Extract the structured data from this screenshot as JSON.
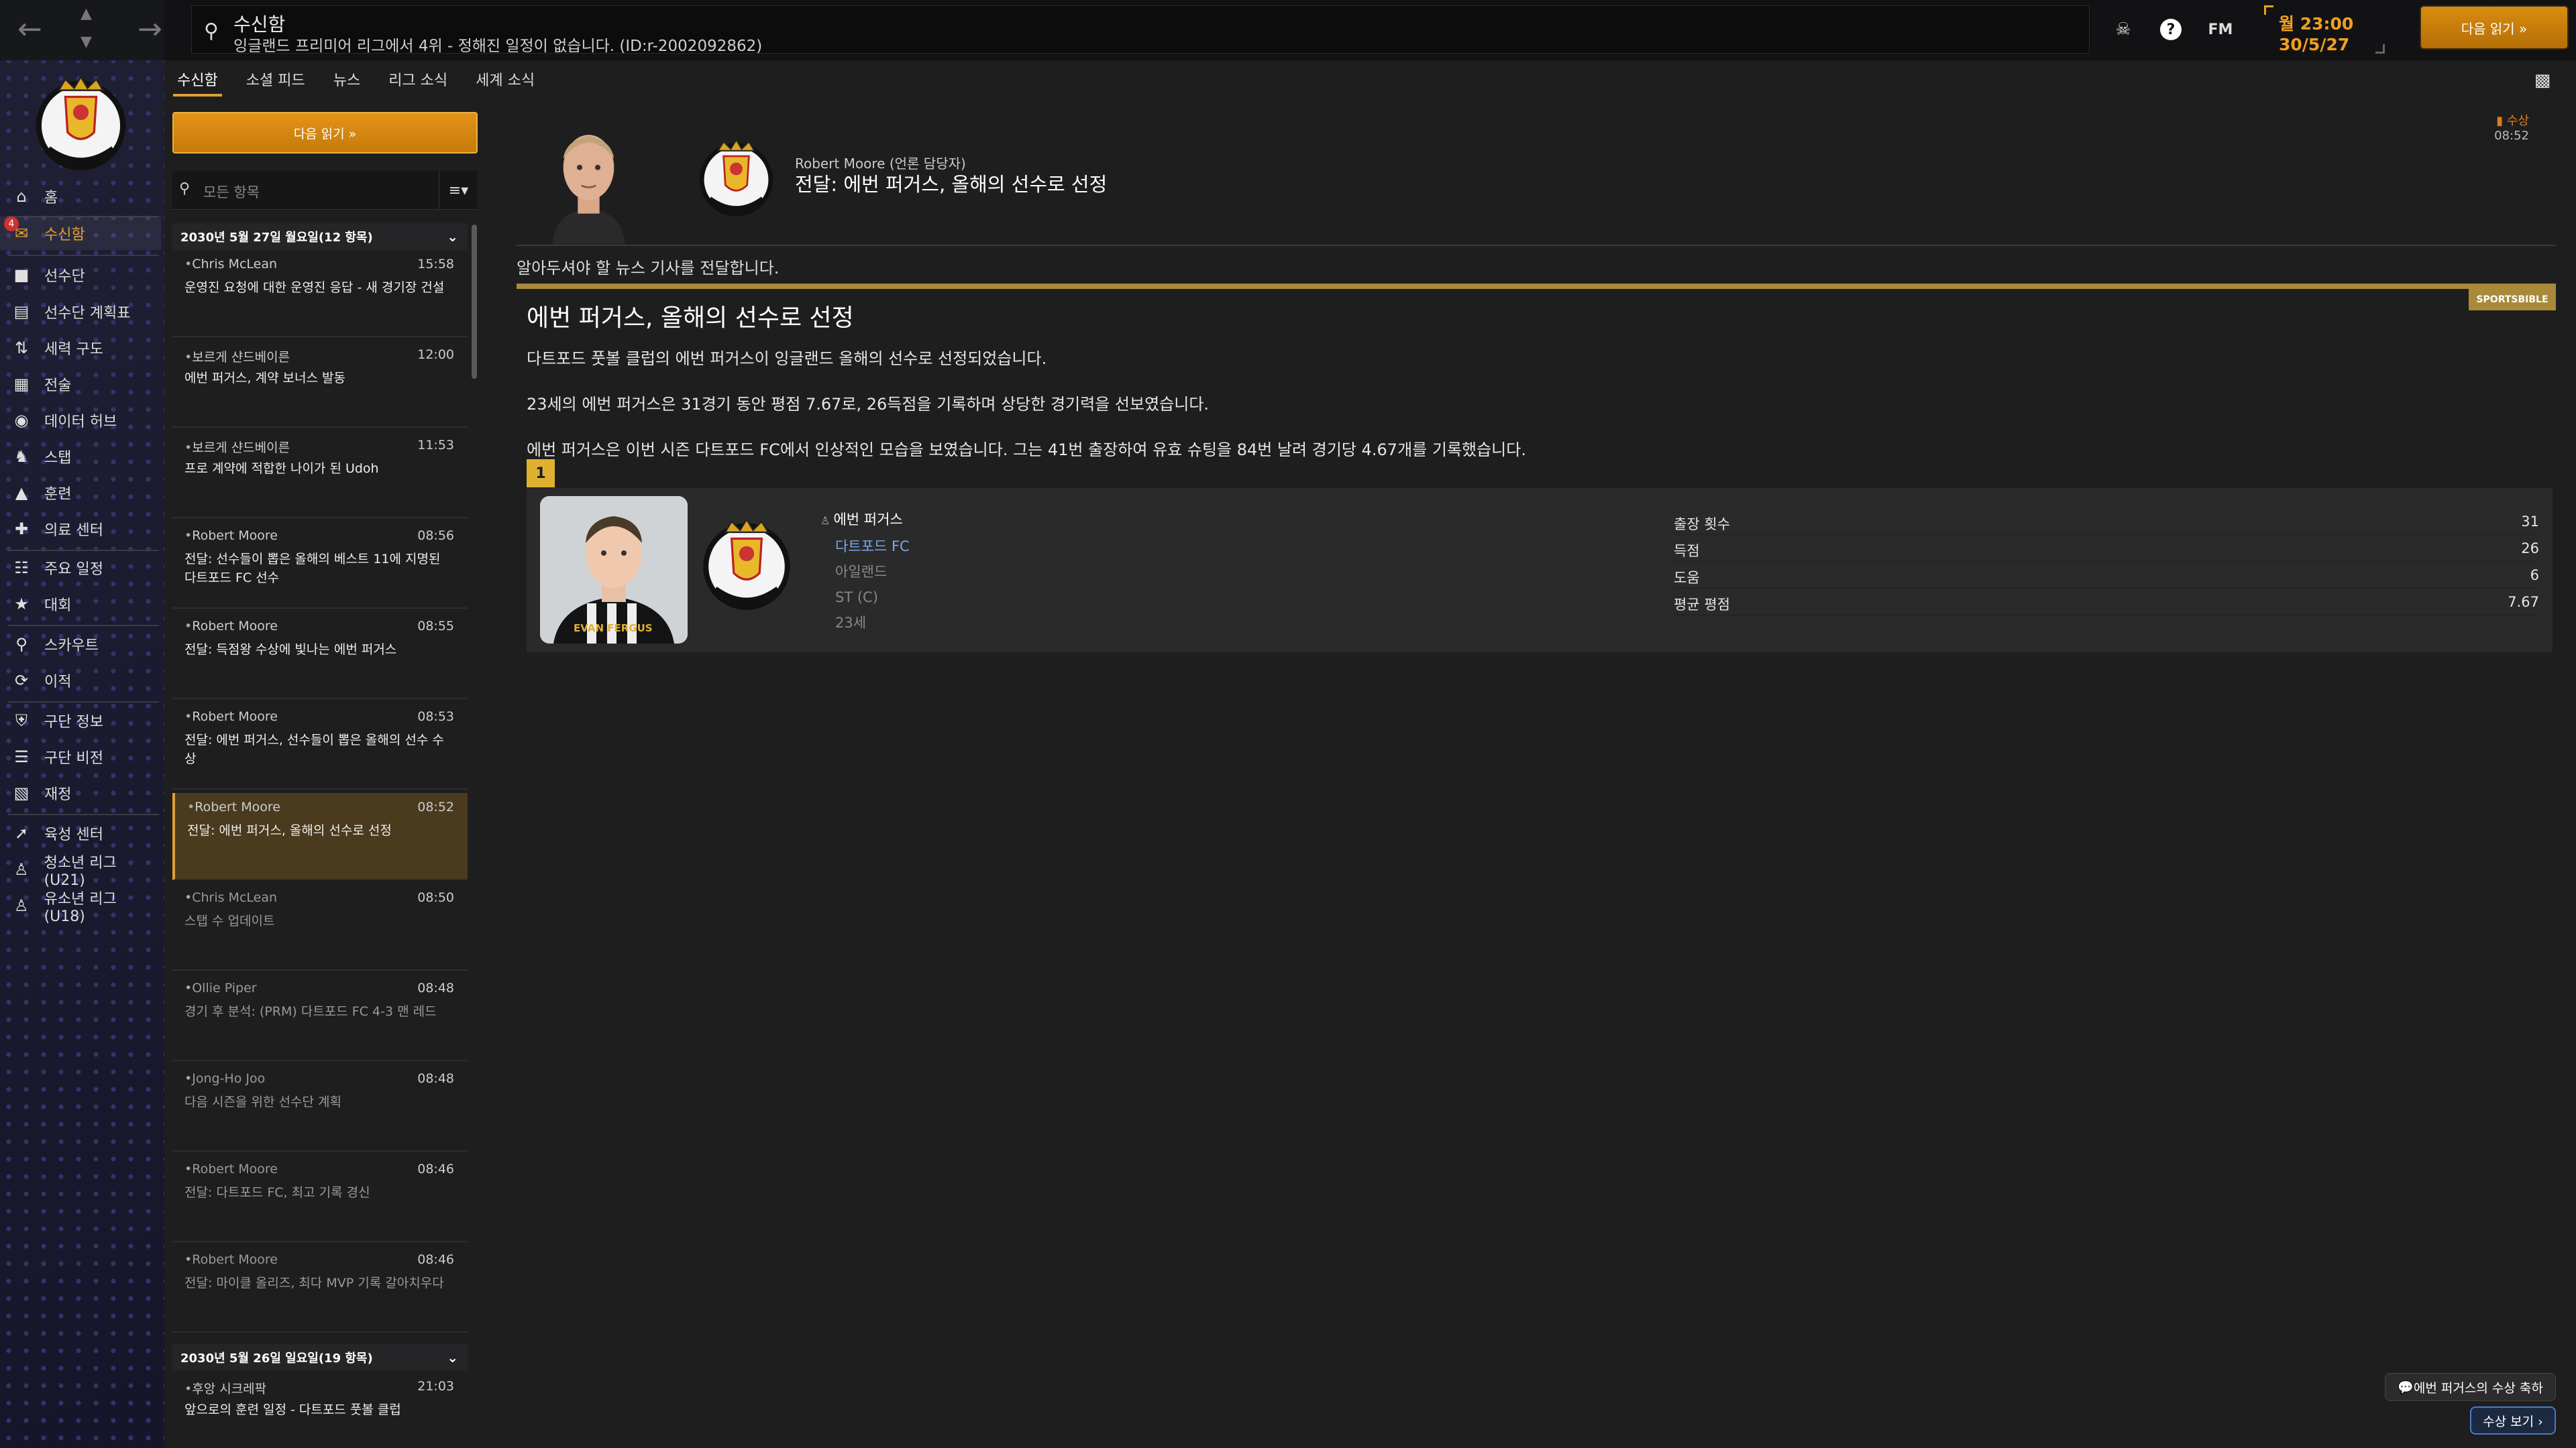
{
  "top": {
    "title": "수신함",
    "subtitle": "잉글랜드 프리미어 리그에서 4위 - 정해진 일정이 없습니다. (ID:r-2002092862)",
    "fm_label": "FM",
    "date_time": "월 23:00",
    "date_day": "30/5/27",
    "continue_label": "다음 읽기 »"
  },
  "sidebar": {
    "items": [
      {
        "label": "홈",
        "icon": "home-icon"
      },
      {
        "label": "수신함",
        "icon": "inbox-icon",
        "badge": "4"
      },
      {
        "label": "선수단",
        "icon": "shirt-icon"
      },
      {
        "label": "선수단 계획표",
        "icon": "clipboard-icon"
      },
      {
        "label": "세력 구도",
        "icon": "hierarchy-icon"
      },
      {
        "label": "전술",
        "icon": "tactics-icon"
      },
      {
        "label": "데이터 허브",
        "icon": "data-hub-icon"
      },
      {
        "label": "스탭",
        "icon": "staff-icon"
      },
      {
        "label": "훈련",
        "icon": "training-icon"
      },
      {
        "label": "의료 센터",
        "icon": "medical-icon"
      },
      {
        "label": "주요 일정",
        "icon": "calendar-icon"
      },
      {
        "label": "대회",
        "icon": "trophy-icon"
      },
      {
        "label": "스카우트",
        "icon": "scout-icon"
      },
      {
        "label": "이적",
        "icon": "transfer-icon"
      },
      {
        "label": "구단 정보",
        "icon": "club-info-icon"
      },
      {
        "label": "구단 비전",
        "icon": "club-vision-icon"
      },
      {
        "label": "재정",
        "icon": "finance-icon"
      },
      {
        "label": "육성 센터",
        "icon": "development-icon"
      },
      {
        "label": "청소년 리그 (U21)",
        "icon": "u21-icon"
      },
      {
        "label": "유소년 리그 (U18)",
        "icon": "u18-icon"
      }
    ]
  },
  "tabs": [
    "수신함",
    "소셜 피드",
    "뉴스",
    "리그 소식",
    "세계 소식"
  ],
  "inbox": {
    "read_next": "다음 읽기 »",
    "filter_placeholder": "모든 항목",
    "groups": [
      {
        "header": "2030년 5월 27일 월요일(12 항목)",
        "messages": [
          {
            "sender": "Chris McLean",
            "time": "15:58",
            "subject": "운영진 요청에 대한 운영진 응답 - 새 경기장 건설"
          },
          {
            "sender": "보르게 샨드베이른",
            "time": "12:00",
            "subject": "에번 퍼거스, 계약 보너스 발동"
          },
          {
            "sender": "보르게 샨드베이른",
            "time": "11:53",
            "subject": "프로 계약에 적합한 나이가 된 Udoh"
          },
          {
            "sender": "Robert Moore",
            "time": "08:56",
            "subject": "전달: 선수들이 뽑은 올해의 베스트 11에 지명된 다트포드 FC 선수"
          },
          {
            "sender": "Robert Moore",
            "time": "08:55",
            "subject": "전달: 득점왕 수상에 빛나는 에번 퍼거스"
          },
          {
            "sender": "Robert Moore",
            "time": "08:53",
            "subject": "전달: 에번 퍼거스, 선수들이 뽑은 올해의 선수 수상"
          },
          {
            "sender": "Robert Moore",
            "time": "08:52",
            "subject": "전달: 에번 퍼거스, 올해의 선수로 선정"
          },
          {
            "sender": "Chris McLean",
            "time": "08:50",
            "subject": "스탭 수 업데이트"
          },
          {
            "sender": "Ollie Piper",
            "time": "08:48",
            "subject": "경기 후 분석: (PRM) 다트포드 FC 4-3 맨 레드"
          },
          {
            "sender": "Jong-Ho Joo",
            "time": "08:48",
            "subject": "다음 시즌을 위한 선수단 계획"
          },
          {
            "sender": "Robert Moore",
            "time": "08:46",
            "subject": "전달: 다트포드 FC, 최고 기록 경신"
          },
          {
            "sender": "Robert Moore",
            "time": "08:46",
            "subject": "전달: 마이클 올리즈, 최다 MVP 기록 갈아치우다"
          }
        ]
      },
      {
        "header": "2030년 5월 26일 일요일(19 항목)",
        "messages": [
          {
            "sender": "후앙 시크레팍",
            "time": "21:03",
            "subject": "앞으로의 훈련 일정 - 다트포드 풋볼 클럽"
          }
        ]
      }
    ]
  },
  "article": {
    "author": "Robert Moore (언론 담당자)",
    "headline": "전달: 에번 퍼거스, 올해의 선수로 선정",
    "tag": "수상",
    "time": "08:52",
    "intro": "알아두셔야 할 뉴스 기사를 전달합니다.",
    "source": "SPORTSBIBLE",
    "title": "에번 퍼거스, 올해의 선수로 선정",
    "paragraphs": [
      "다트포드 풋볼 클럽의 에번 퍼거스이 잉글랜드 올해의 선수로 선정되었습니다.",
      "23세의 에번 퍼거스은 31경기 동안 평점 7.67로, 26득점을 기록하며 상당한 경기력을 선보였습니다.",
      "에번 퍼거스은 이번 시즌 다트포드 FC에서 인상적인 모습을 보였습니다. 그는 41번 출장하여 유효 슈팅을 84번 날려 경기당 4.67개를 기록했습니다."
    ],
    "rank": "1",
    "player": {
      "name": "에번 퍼거스",
      "club": "다트포드 FC",
      "nation": "아일랜드",
      "position": "ST (C)",
      "age": "23세",
      "shirt_text": "EVAN FERGUS"
    },
    "stats": [
      {
        "label": "출장 횟수",
        "value": "31"
      },
      {
        "label": "득점",
        "value": "26"
      },
      {
        "label": "도움",
        "value": "6"
      },
      {
        "label": "평균 평점",
        "value": "7.67"
      }
    ]
  },
  "footer": {
    "congrats": "에번 퍼거스의 수상 축하",
    "view_award": "수상 보기 ›"
  }
}
